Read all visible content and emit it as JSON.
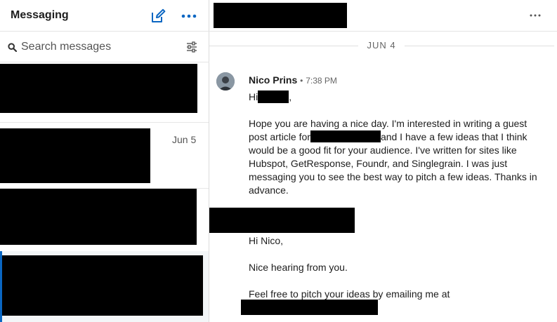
{
  "sidebar": {
    "title": "Messaging",
    "compose_icon": "compose-icon",
    "more_icon": "more-horizontal-icon",
    "search": {
      "placeholder": "Search messages",
      "icon": "search-icon",
      "filter_icon": "filter-icon"
    },
    "conversations": [
      {
        "date": ""
      },
      {
        "date": "Jun 5"
      },
      {
        "date": ""
      },
      {
        "date": ""
      }
    ]
  },
  "thread": {
    "more_icon": "more-horizontal-icon",
    "date_divider": "JUN 4",
    "messages": [
      {
        "sender": "Nico Prins",
        "separator": "•",
        "time": "7:38 PM",
        "greeting_prefix": "Hi",
        "greeting_suffix": ",",
        "body_1": "Hope you are having a nice day. I'm interested in writing a guest post article for",
        "body_2": "and I have a few ideas that I think would be a good fit for your audience. I've written for sites like Hubspot, GetResponse, Foundr, and Singlegrain. I was just messaging you to see the best way to pitch a few ideas. Thanks in advance."
      },
      {
        "line_1": "Hi Nico,",
        "line_2": "Nice hearing from you.",
        "line_3": "Feel free to pitch your ideas by emailing me at"
      }
    ]
  },
  "colors": {
    "accent": "#0a66c2",
    "redaction": "#000000",
    "selected_row": "#f3f6f8"
  }
}
